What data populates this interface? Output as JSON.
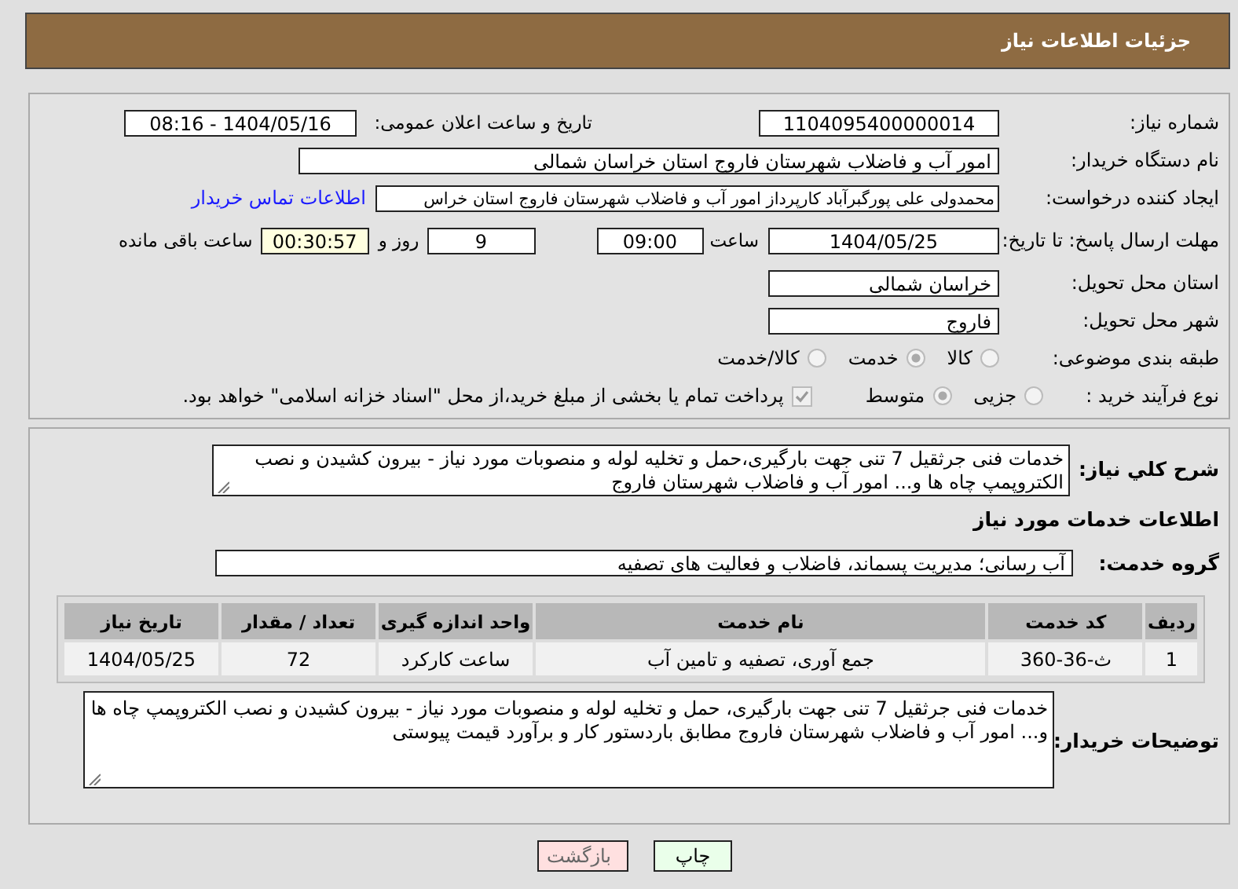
{
  "header": {
    "title": "جزئیات اطلاعات نیاز"
  },
  "general": {
    "rows": [
      {
        "label": "شماره نیاز:",
        "parts": [
          {
            "kind": "field",
            "value": "1104095400000014"
          },
          {
            "kind": "label",
            "text": "تاریخ و ساعت اعلان عمومی:"
          },
          {
            "kind": "field",
            "value": "1404/05/16 - 08:16"
          }
        ]
      },
      {
        "label": "نام دستگاه خریدار:",
        "parts": [
          {
            "kind": "field",
            "value": "امور آب و فاضلاب شهرستان فاروج استان خراسان شمالی"
          }
        ]
      },
      {
        "label": "ایجاد کننده درخواست:",
        "parts": [
          {
            "kind": "field",
            "value": "محمدولی علی پورگبرآباد کارپرداز امور آب و فاضلاب شهرستان فاروج استان خراس"
          },
          {
            "kind": "link",
            "text": "اطلاعات تماس خریدار"
          }
        ]
      },
      {
        "label": "مهلت ارسال پاسخ: تا تاریخ:",
        "parts": [
          {
            "kind": "field",
            "value": "1404/05/25"
          },
          {
            "kind": "label",
            "text": "ساعت"
          },
          {
            "kind": "field",
            "value": "09:00"
          },
          {
            "kind": "field",
            "value": "9"
          },
          {
            "kind": "label",
            "text": "روز و"
          },
          {
            "kind": "timer",
            "value": "00:30:57"
          },
          {
            "kind": "label",
            "text": "ساعت باقی مانده"
          }
        ]
      },
      {
        "label": "استان محل تحویل:",
        "parts": [
          {
            "kind": "field",
            "value": "خراسان شمالی"
          }
        ]
      },
      {
        "label": "شهر محل تحویل:",
        "parts": [
          {
            "kind": "field",
            "value": "فاروج"
          }
        ]
      },
      {
        "label": "طبقه بندی موضوعی:",
        "parts": [
          {
            "kind": "radio",
            "text": "کالا",
            "selected": false
          },
          {
            "kind": "radio",
            "text": "خدمت",
            "selected": true
          },
          {
            "kind": "radio",
            "text": "کالا/خدمت",
            "selected": false
          }
        ]
      },
      {
        "label": "نوع فرآیند خرید :",
        "parts": [
          {
            "kind": "radio",
            "text": "جزیی",
            "selected": false
          },
          {
            "kind": "radio",
            "text": "متوسط",
            "selected": true
          },
          {
            "kind": "checkbox",
            "text": "پرداخت تمام یا بخشی از مبلغ خرید،از محل \"اسناد خزانه اسلامی\" خواهد بود.",
            "checked": true
          }
        ]
      }
    ]
  },
  "details": {
    "summary": {
      "label": "شرح کلي نیاز:",
      "value": "خدمات فنی جرثقیل 7 تنی جهت بارگیری،حمل و تخلیه لوله و منصوبات مورد نیاز - بیرون کشیدن و نصب الکتروپمپ چاه ها و... امور آب و فاضلاب شهرستان فاروج"
    },
    "section_title": "اطلاعات خدمات مورد نیاز",
    "service_group": {
      "label": "گروه خدمت:",
      "value": "آب رسانی؛ مدیریت پسماند، فاضلاب و فعالیت های تصفیه"
    },
    "table": {
      "columns": [
        "ردیف",
        "کد خدمت",
        "نام خدمت",
        "واحد اندازه گیری",
        "تعداد / مقدار",
        "تاریخ نیاز"
      ],
      "rows": [
        [
          "1",
          "ث-36-360",
          "جمع آوری، تصفیه و تامین آب",
          "ساعت کارکرد",
          "72",
          "1404/05/25"
        ]
      ]
    },
    "buyer_notes": {
      "label": "توضیحات خریدار:",
      "value": "خدمات فنی جرثقیل 7 تنی جهت بارگیری، حمل و تخلیه لوله و منصوبات مورد نیاز - بیرون کشیدن و نصب الکتروپمپ چاه ها و... امور آب و فاضلاب شهرستان فاروج مطابق باردستور کار و برآورد قیمت پیوستی"
    }
  },
  "buttons": [
    {
      "kind": "print",
      "label": "چاپ"
    },
    {
      "kind": "back",
      "label": "بازگشت"
    }
  ]
}
